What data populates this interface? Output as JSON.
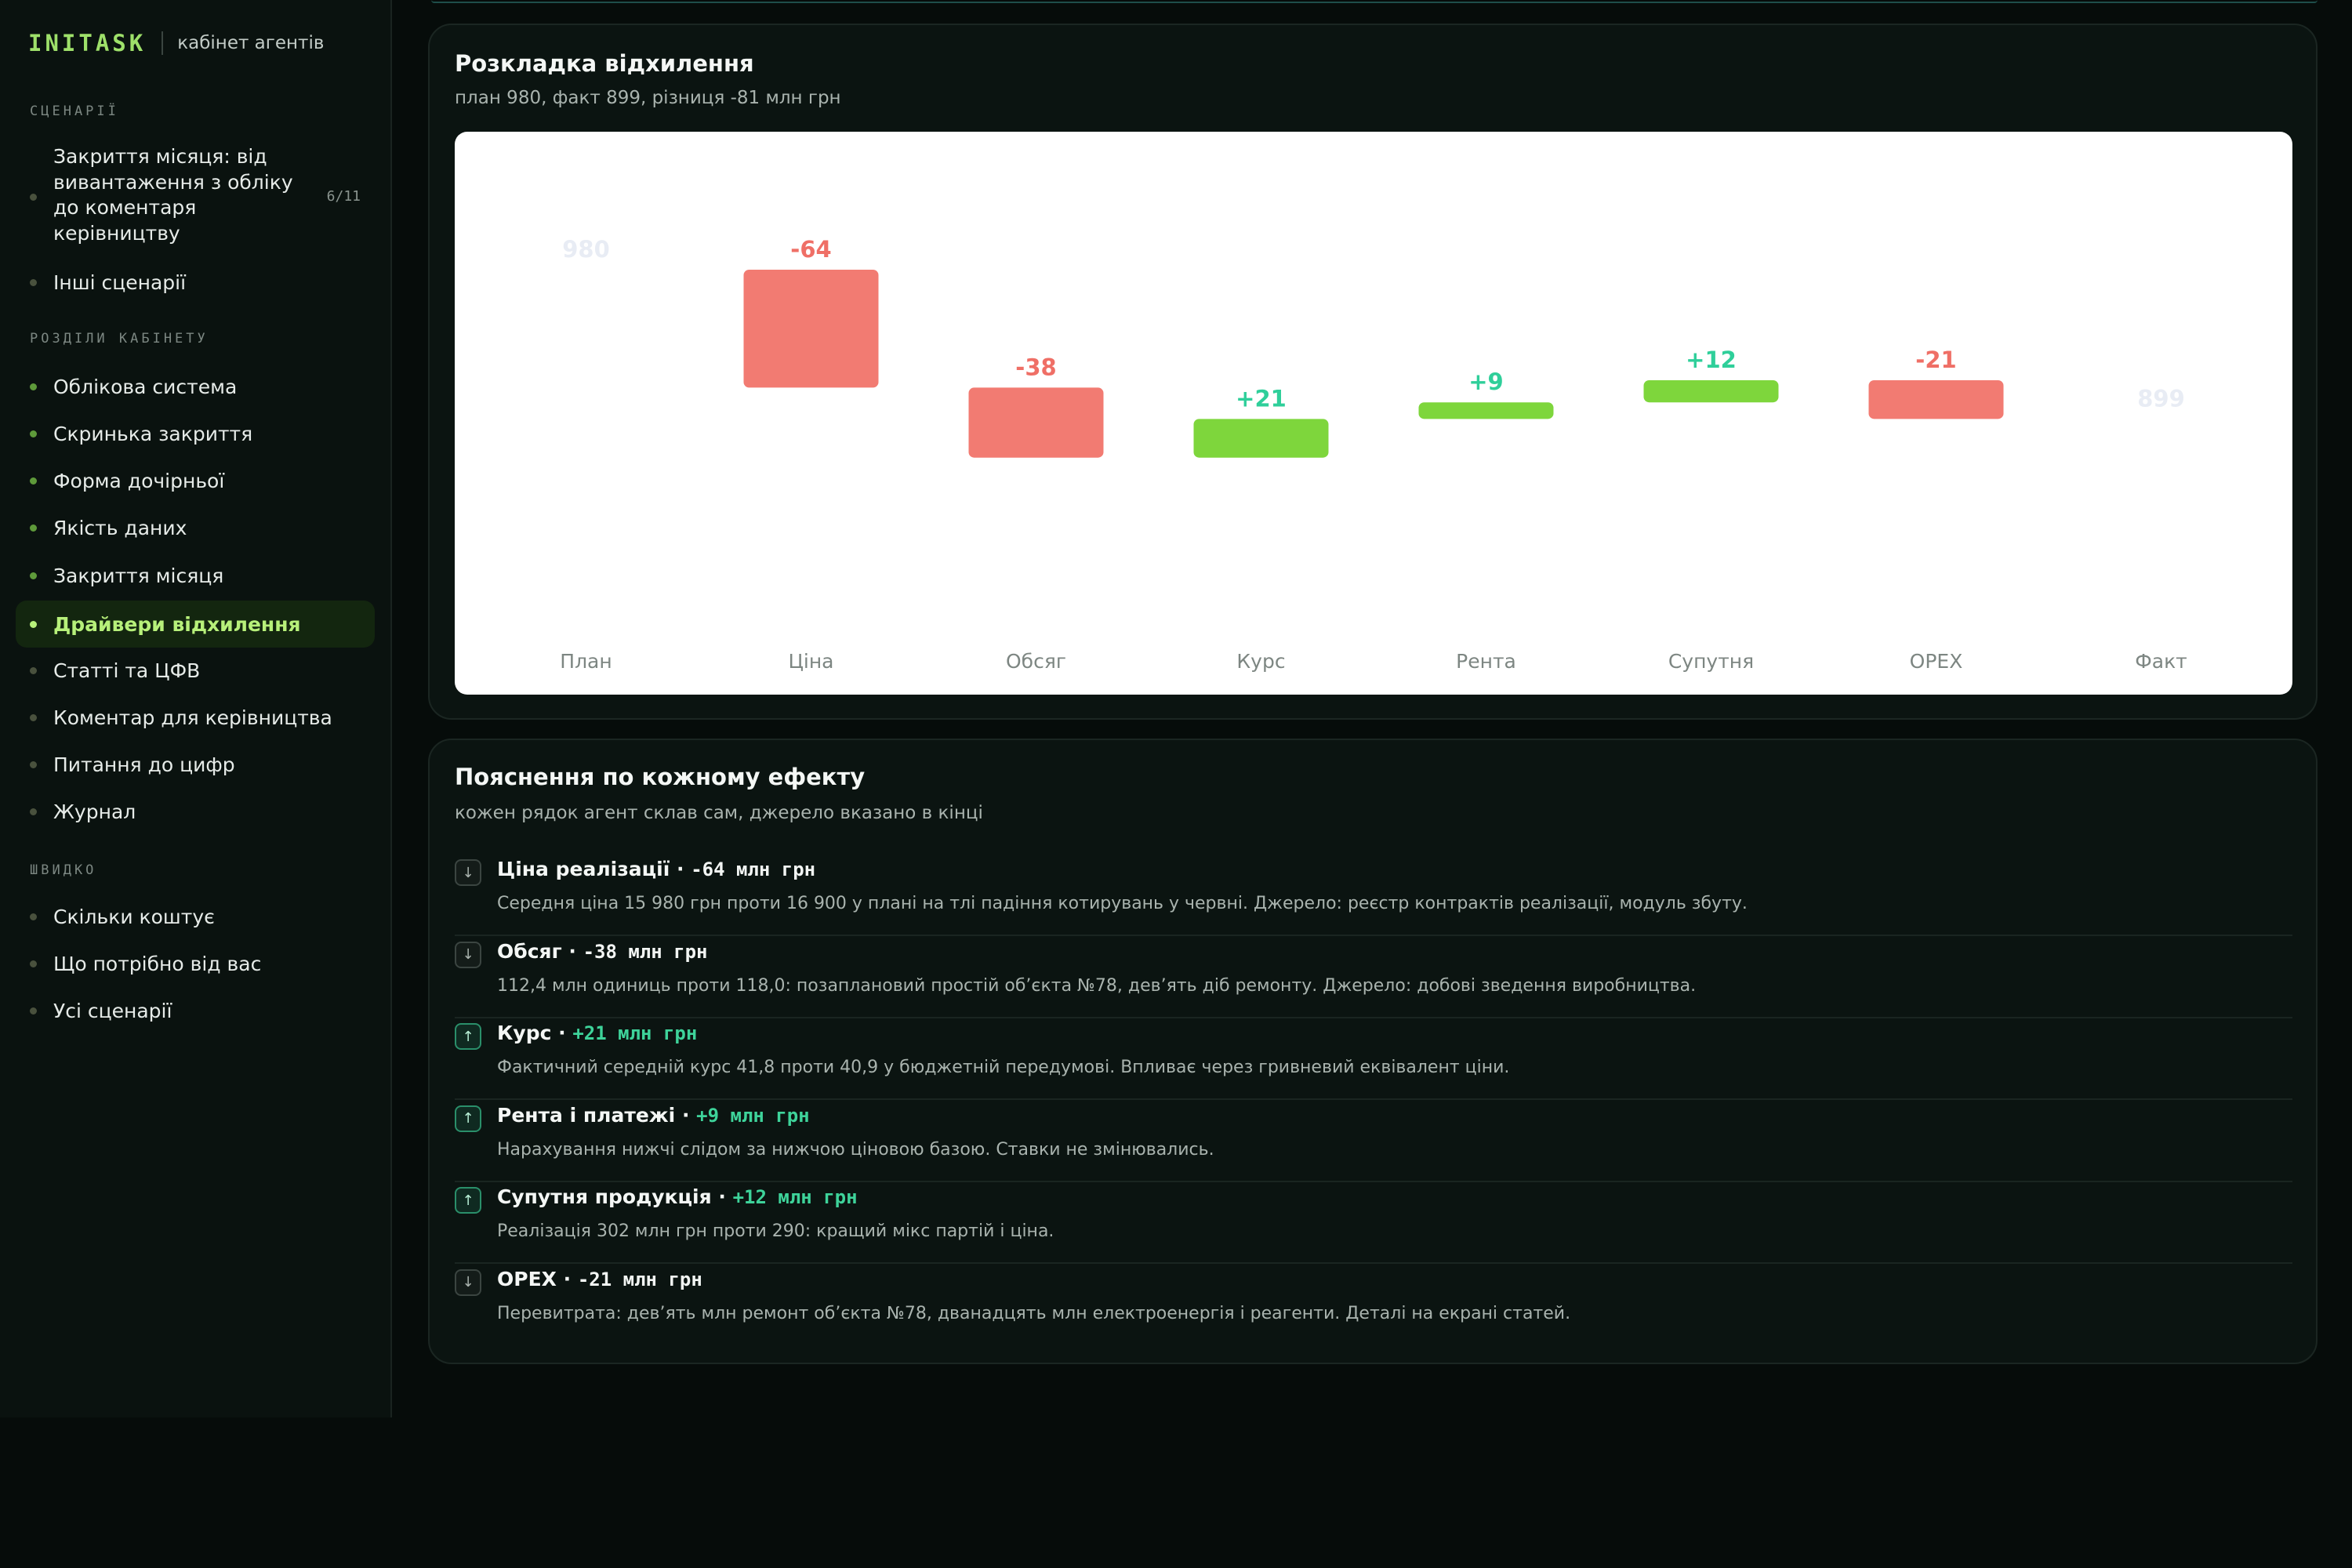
{
  "brand": {
    "name": "INITASK",
    "subtitle": "кабінет агентів"
  },
  "sidebar": {
    "scenarios_label": "СЦЕНАРІЇ",
    "scenarios": [
      {
        "label": "Закриття місяця: від вивантаження з обліку до коментаря керівництву",
        "count": "6/11"
      },
      {
        "label": "Інші сценарії"
      }
    ],
    "sections_label": "РОЗДІЛИ КАБІНЕТУ",
    "sections": [
      {
        "label": "Облікова система"
      },
      {
        "label": "Скринька закриття"
      },
      {
        "label": "Форма дочірньої"
      },
      {
        "label": "Якість даних"
      },
      {
        "label": "Закриття місяця"
      },
      {
        "label": "Драйвери відхилення",
        "active": true
      },
      {
        "label": "Статті та ЦФВ"
      },
      {
        "label": "Коментар для керівництва"
      },
      {
        "label": "Питання до цифр"
      },
      {
        "label": "Журнал"
      }
    ],
    "quick_label": "ШВИДКО",
    "quick": [
      {
        "label": "Скільки коштує"
      },
      {
        "label": "Що потрібно від вас"
      },
      {
        "label": "Усі сценарії"
      }
    ]
  },
  "waterfall": {
    "title": "Розкладка відхилення",
    "subtitle": "план 980, факт 899, різниця -81 млн грн"
  },
  "chart_data": {
    "type": "bar",
    "subtype": "waterfall",
    "categories": [
      "План",
      "Ціна",
      "Обсяг",
      "Курс",
      "Рента",
      "Супутня",
      "OPEX",
      "Факт"
    ],
    "values": [
      980,
      -64,
      -38,
      21,
      9,
      12,
      -21,
      899
    ],
    "labels": [
      "980",
      "-64",
      "-38",
      "+21",
      "+9",
      "+12",
      "-21",
      "899"
    ],
    "total_indices": [
      0,
      7
    ],
    "colors": {
      "negative": "#f27b72",
      "positive": "#7ed63c",
      "total_label": "#e8ecf4",
      "neg_label": "#ef6f66",
      "pos_label": "#2fcf9a"
    }
  },
  "effects": {
    "title": "Пояснення по кожному ефекту",
    "subtitle": "кожен рядок агент склав сам, джерело вказано в кінці",
    "items": [
      {
        "name": "Ціна реалізації",
        "amount": "-64 млн грн",
        "dir": "down",
        "icon": "arrow-down-icon",
        "desc": "Середня ціна 15 980 грн проти 16 900 у плані на тлі падіння котирувань у червні. Джерело: реєстр контрактів реалізації, модуль збуту."
      },
      {
        "name": "Обсяг",
        "amount": "-38 млн грн",
        "dir": "down",
        "icon": "arrow-down-icon",
        "desc": "112,4 млн одиниць проти 118,0: позаплановий простій об’єкта №78, дев’ять діб ремонту. Джерело: добові зведення виробництва."
      },
      {
        "name": "Курс",
        "amount": "+21 млн грн",
        "dir": "up",
        "icon": "arrow-up-icon",
        "desc": "Фактичний середній курс 41,8 проти 40,9 у бюджетній передумові. Впливає через гривневий еквівалент ціни."
      },
      {
        "name": "Рента і платежі",
        "amount": "+9 млн грн",
        "dir": "up",
        "icon": "arrow-up-icon",
        "desc": "Нарахування нижчі слідом за нижчою ціновою базою. Ставки не змінювались."
      },
      {
        "name": "Супутня продукція",
        "amount": "+12 млн грн",
        "dir": "up",
        "icon": "arrow-up-icon",
        "desc": "Реалізація 302 млн грн проти 290: кращий мікс партій і ціна."
      },
      {
        "name": "OPEX",
        "amount": "-21 млн грн",
        "dir": "down",
        "icon": "arrow-down-icon",
        "desc": "Перевитрата: дев’ять млн ремонт об’єкта №78, дванадцять млн електроенергія і реагенти. Деталі на екрані статей."
      }
    ]
  }
}
